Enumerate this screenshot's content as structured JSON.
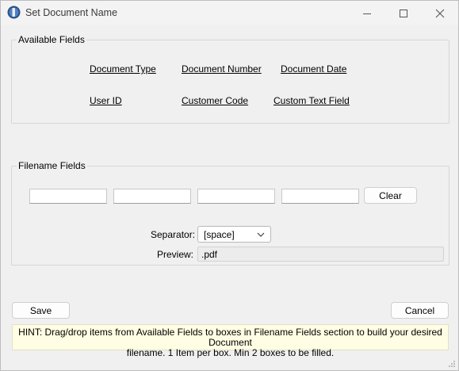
{
  "window": {
    "title": "Set Document Name",
    "minimize_icon": "minimize-icon",
    "maximize_icon": "maximize-icon",
    "close_icon": "close-icon"
  },
  "available_fields": {
    "label": "Available Fields",
    "items": [
      {
        "label": "Document Type"
      },
      {
        "label": "Document Number"
      },
      {
        "label": "Document Date"
      },
      {
        "label": "User ID"
      },
      {
        "label": "Customer Code"
      },
      {
        "label": "Custom Text Field"
      }
    ]
  },
  "filename_fields": {
    "label": "Filename Fields",
    "boxes": [
      "",
      "",
      "",
      ""
    ],
    "clear_label": "Clear",
    "separator_label": "Separator:",
    "separator_value": "[space]",
    "preview_label": "Preview:",
    "preview_value": ".pdf"
  },
  "footer": {
    "save_label": "Save",
    "cancel_label": "Cancel",
    "hint_line1": "HINT: Drag/drop items from Available Fields to boxes in Filename Fields section to build your desired Document",
    "hint_line2": "filename. 1 Item per box. Min 2 boxes to be filled."
  }
}
